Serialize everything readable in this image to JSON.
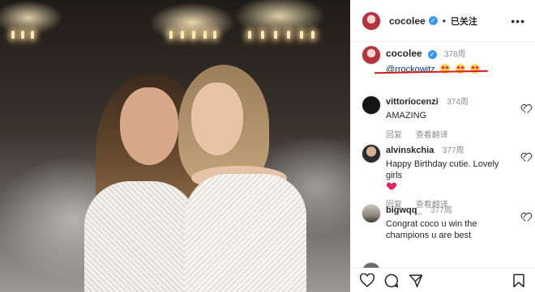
{
  "post": {
    "author": "cocolee",
    "follow_status": "已关注",
    "more_label": "•••",
    "caption": {
      "author": "cocolee",
      "time": "378周",
      "mention": "@rrockowitz",
      "emojis": [
        "heart-eyes-emoji",
        "heart-eyes-emoji",
        "heart-eyes-emoji"
      ]
    }
  },
  "comments": [
    {
      "user": "vittoriocenzi",
      "time": "374周",
      "text": "AMAZING",
      "reply": "回复",
      "translate": "查看翻译",
      "avatar": "dark"
    },
    {
      "user": "alvinskchia",
      "time": "377周",
      "text": "Happy Birthday cutie. Lovely girls",
      "reply": "回复",
      "translate": "查看翻译",
      "avatar": "face",
      "trailing_emoji": "red-heart-emoji"
    },
    {
      "user": "bigwqq_",
      "time": "377周",
      "text": "Congrat coco u win the champions u are best",
      "avatar": "sunset"
    }
  ],
  "bottom_actions": [
    "heart-icon",
    "comment-icon",
    "share-icon",
    "bookmark-icon"
  ],
  "colors": {
    "verified": "#3897f0",
    "mention": "#00376b",
    "underline": "#d11f1f",
    "secondary_text": "#8e8e8e"
  }
}
